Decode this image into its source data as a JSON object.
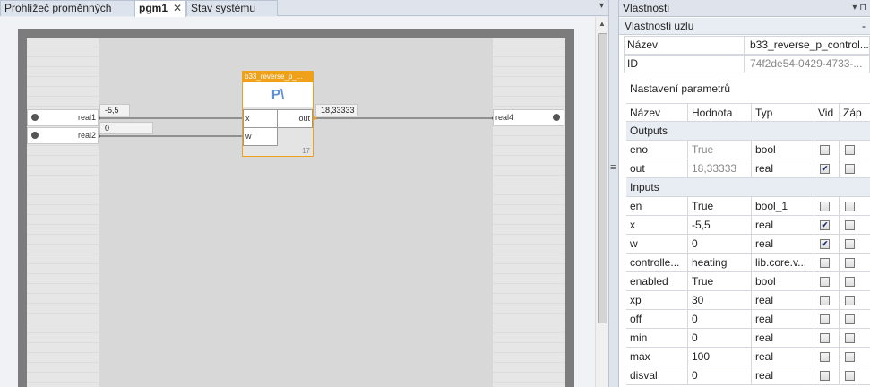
{
  "tabs": [
    {
      "label": "Prohlížeč proměnných",
      "active": false
    },
    {
      "label": "pgm1",
      "active": true,
      "close": "✕"
    },
    {
      "label": "Stav systému",
      "active": false
    }
  ],
  "tab_menu_glyph": "▾",
  "diagram": {
    "inputs": [
      {
        "name": "real1",
        "value": "-5,5"
      },
      {
        "name": "real2",
        "value": "0"
      }
    ],
    "output": {
      "name": "real4",
      "value": "18,33333"
    },
    "block": {
      "title": "b33_reverse_p_...",
      "symbol": "P\\",
      "pins_in": [
        "x",
        "w"
      ],
      "pin_out": "out",
      "number": "17"
    }
  },
  "panel": {
    "title": "Vlastnosti",
    "pin_glyph": "▾ ⊓",
    "section": "Vlastnosti uzlu",
    "section_toggle": "-",
    "name_label": "Název",
    "name_value": "b33_reverse_p_control...",
    "id_label": "ID",
    "id_value": "74f2de54-0429-4733-...",
    "params_title": "Nastavení parametrů",
    "columns": [
      "Název",
      "Hodnota",
      "Typ",
      "Vid",
      "Záp"
    ],
    "groups": [
      {
        "label": "Outputs",
        "rows": [
          {
            "name": "eno",
            "value": "True",
            "type": "bool",
            "vid": false,
            "zap": false,
            "readonly": true
          },
          {
            "name": "out",
            "value": "18,33333",
            "type": "real",
            "vid": true,
            "zap": false,
            "readonly": true
          }
        ]
      },
      {
        "label": "Inputs",
        "rows": [
          {
            "name": "en",
            "value": "True",
            "type": "bool_1",
            "vid": false,
            "zap": false,
            "readonly": false
          },
          {
            "name": "x",
            "value": "-5,5",
            "type": "real",
            "vid": true,
            "zap": false,
            "readonly": false
          },
          {
            "name": "w",
            "value": "0",
            "type": "real",
            "vid": true,
            "zap": false,
            "readonly": false
          },
          {
            "name": "controlle...",
            "value": "heating",
            "type": "lib.core.v...",
            "vid": false,
            "zap": false,
            "readonly": false
          },
          {
            "name": "enabled",
            "value": "True",
            "type": "bool",
            "vid": false,
            "zap": false,
            "readonly": false
          },
          {
            "name": "xp",
            "value": "30",
            "type": "real",
            "vid": false,
            "zap": false,
            "readonly": false
          },
          {
            "name": "off",
            "value": "0",
            "type": "real",
            "vid": false,
            "zap": false,
            "readonly": false
          },
          {
            "name": "min",
            "value": "0",
            "type": "real",
            "vid": false,
            "zap": false,
            "readonly": false
          },
          {
            "name": "max",
            "value": "100",
            "type": "real",
            "vid": false,
            "zap": false,
            "readonly": false
          },
          {
            "name": "disval",
            "value": "0",
            "type": "real",
            "vid": false,
            "zap": false,
            "readonly": false
          }
        ]
      }
    ]
  },
  "colors": {
    "block_accent": "#f0a11a",
    "symbol": "#5b8fd6"
  }
}
